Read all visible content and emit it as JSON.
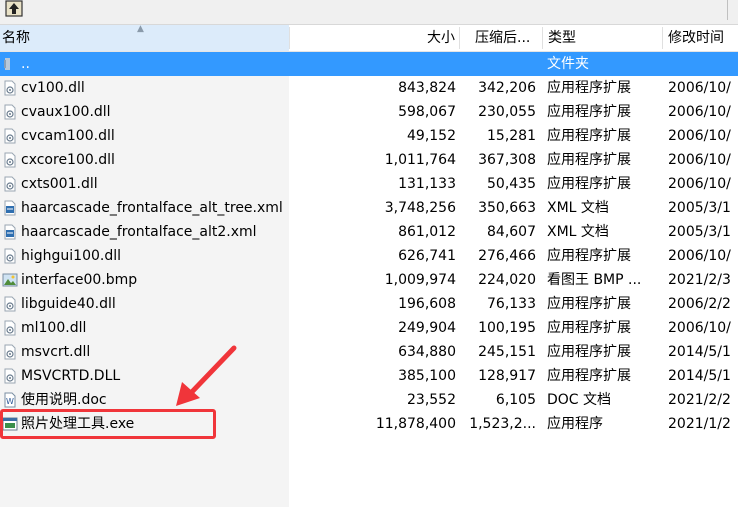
{
  "columns": {
    "name": "名称",
    "size": "大小",
    "compressed": "压缩后...",
    "type": "类型",
    "modified": "修改时间"
  },
  "rows": [
    {
      "name": "..",
      "size": "",
      "compressed": "",
      "type": "文件夹",
      "modified": "",
      "icon": "folder-up-icon",
      "selected": true
    },
    {
      "name": "cv100.dll",
      "size": "843,824",
      "compressed": "342,206",
      "type": "应用程序扩展",
      "modified": "2006/10/",
      "icon": "dll-file-icon"
    },
    {
      "name": "cvaux100.dll",
      "size": "598,067",
      "compressed": "230,055",
      "type": "应用程序扩展",
      "modified": "2006/10/",
      "icon": "dll-file-icon"
    },
    {
      "name": "cvcam100.dll",
      "size": "49,152",
      "compressed": "15,281",
      "type": "应用程序扩展",
      "modified": "2006/10/",
      "icon": "dll-file-icon"
    },
    {
      "name": "cxcore100.dll",
      "size": "1,011,764",
      "compressed": "367,308",
      "type": "应用程序扩展",
      "modified": "2006/10/",
      "icon": "dll-file-icon"
    },
    {
      "name": "cxts001.dll",
      "size": "131,133",
      "compressed": "50,435",
      "type": "应用程序扩展",
      "modified": "2006/10/",
      "icon": "dll-file-icon"
    },
    {
      "name": "haarcascade_frontalface_alt_tree.xml",
      "size": "3,748,256",
      "compressed": "350,663",
      "type": "XML 文档",
      "modified": "2005/3/1",
      "icon": "xml-file-icon"
    },
    {
      "name": "haarcascade_frontalface_alt2.xml",
      "size": "861,012",
      "compressed": "84,607",
      "type": "XML 文档",
      "modified": "2005/3/1",
      "icon": "xml-file-icon"
    },
    {
      "name": "highgui100.dll",
      "size": "626,741",
      "compressed": "276,466",
      "type": "应用程序扩展",
      "modified": "2006/10/",
      "icon": "dll-file-icon"
    },
    {
      "name": "interface00.bmp",
      "size": "1,009,974",
      "compressed": "224,020",
      "type": "看图王 BMP ...",
      "modified": "2021/2/3",
      "icon": "image-file-icon"
    },
    {
      "name": "libguide40.dll",
      "size": "196,608",
      "compressed": "76,133",
      "type": "应用程序扩展",
      "modified": "2006/2/2",
      "icon": "dll-file-icon"
    },
    {
      "name": "ml100.dll",
      "size": "249,904",
      "compressed": "100,195",
      "type": "应用程序扩展",
      "modified": "2006/10/",
      "icon": "dll-file-icon"
    },
    {
      "name": "msvcrt.dll",
      "size": "634,880",
      "compressed": "245,151",
      "type": "应用程序扩展",
      "modified": "2014/5/1",
      "icon": "dll-file-icon"
    },
    {
      "name": "MSVCRTD.DLL",
      "size": "385,100",
      "compressed": "128,917",
      "type": "应用程序扩展",
      "modified": "2014/5/1",
      "icon": "dll-file-icon"
    },
    {
      "name": "使用说明.doc",
      "size": "23,552",
      "compressed": "6,105",
      "type": "DOC 文档",
      "modified": "2021/2/2",
      "icon": "word-doc-icon"
    },
    {
      "name": "照片处理工具.exe",
      "size": "11,878,400",
      "compressed": "1,523,2...",
      "type": "应用程序",
      "modified": "2021/1/2",
      "icon": "exe-file-icon"
    }
  ],
  "colors": {
    "selection": "#3399ff",
    "annotation": "#f0353a",
    "header_sorted": "#dcebfa"
  }
}
